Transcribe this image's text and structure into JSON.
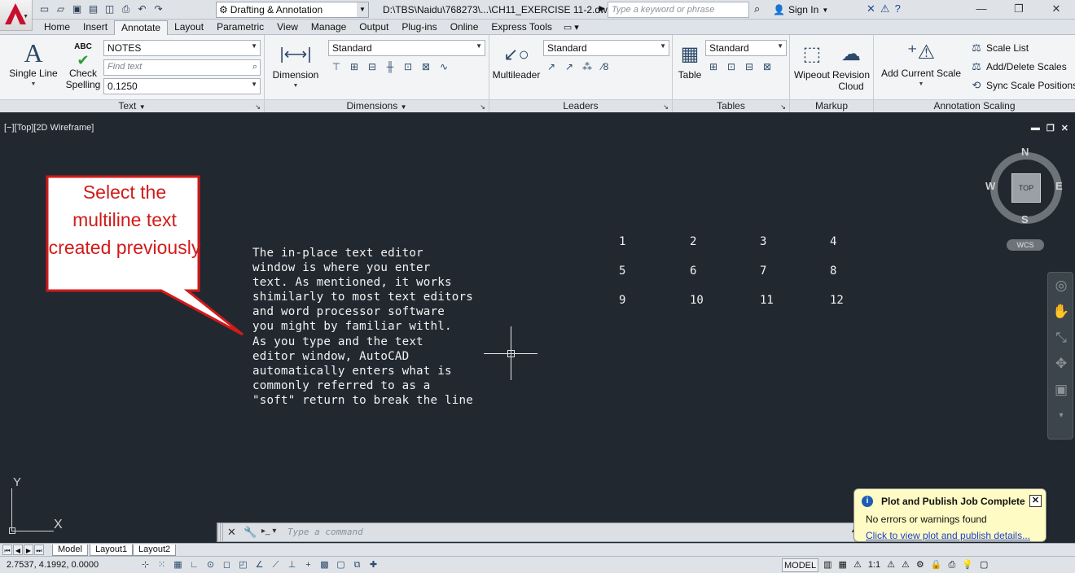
{
  "titlebar": {
    "workspace": "Drafting & Annotation",
    "filepath": "D:\\TBS\\Naidu\\768273\\...\\CH11_EXERCISE 11-2.dwg",
    "search_placeholder": "Type a keyword or phrase",
    "sign_in": "Sign In"
  },
  "tabs": [
    "Home",
    "Insert",
    "Annotate",
    "Layout",
    "Parametric",
    "View",
    "Manage",
    "Output",
    "Plug-ins",
    "Online",
    "Express Tools"
  ],
  "active_tab": "Annotate",
  "ribbon": {
    "text_panel": {
      "title": "Text",
      "single_line": "Single Line",
      "check_spelling_1": "Check",
      "check_spelling_2": "Spelling",
      "abc": "ABC",
      "style": "NOTES",
      "find_placeholder": "Find text",
      "height": "0.1250"
    },
    "dimensions_panel": {
      "title": "Dimensions",
      "dimension": "Dimension",
      "style": "Standard"
    },
    "leaders_panel": {
      "title": "Leaders",
      "multileader": "Multileader",
      "style": "Standard"
    },
    "tables_panel": {
      "title": "Tables",
      "table": "Table",
      "style": "Standard"
    },
    "markup_panel": {
      "title": "Markup",
      "wipeout": "Wipeout",
      "revision_1": "Revision",
      "revision_2": "Cloud"
    },
    "scaling_panel": {
      "title": "Annotation Scaling",
      "add_current_scale": "Add Current Scale",
      "scale_list": "Scale List",
      "add_delete_scales": "Add/Delete Scales",
      "sync_scale_positions": "Sync Scale Positions"
    }
  },
  "viewport": {
    "label": "[−][Top][2D Wireframe]",
    "mtext": "The in-place text editor\nwindow is where you enter\ntext. As mentioned, it works\nshimilarly to most text editors\nand word processor software\nyou might by familiar withl.\nAs you type and the text\neditor window, AutoCAD\nautomatically enters what is\ncommonly referred to as a\n\"soft\" return to break the line",
    "numbers": [
      "1",
      "2",
      "3",
      "4",
      "5",
      "6",
      "7",
      "8",
      "9",
      "10",
      "11",
      "12"
    ],
    "callout": "Select the multiline text created previously",
    "viewcube": {
      "n": "N",
      "s": "S",
      "e": "E",
      "w": "W",
      "top": "TOP",
      "wcs": "WCS"
    },
    "ucs_x": "X",
    "ucs_y": "Y"
  },
  "command": {
    "placeholder": "Type a command"
  },
  "notification": {
    "title": "Plot and Publish Job Complete",
    "message": "No errors or warnings found",
    "link": "Click to view plot and publish details..."
  },
  "layout_tabs": [
    "Model",
    "Layout1",
    "Layout2"
  ],
  "status": {
    "coords": "2.7537, 4.1992, 0.0000",
    "model": "MODEL",
    "scale": "1:1"
  },
  "colors": {
    "canvas": "#212830",
    "callout_red": "#d21a1a",
    "notify_bg": "#fffbc4"
  }
}
